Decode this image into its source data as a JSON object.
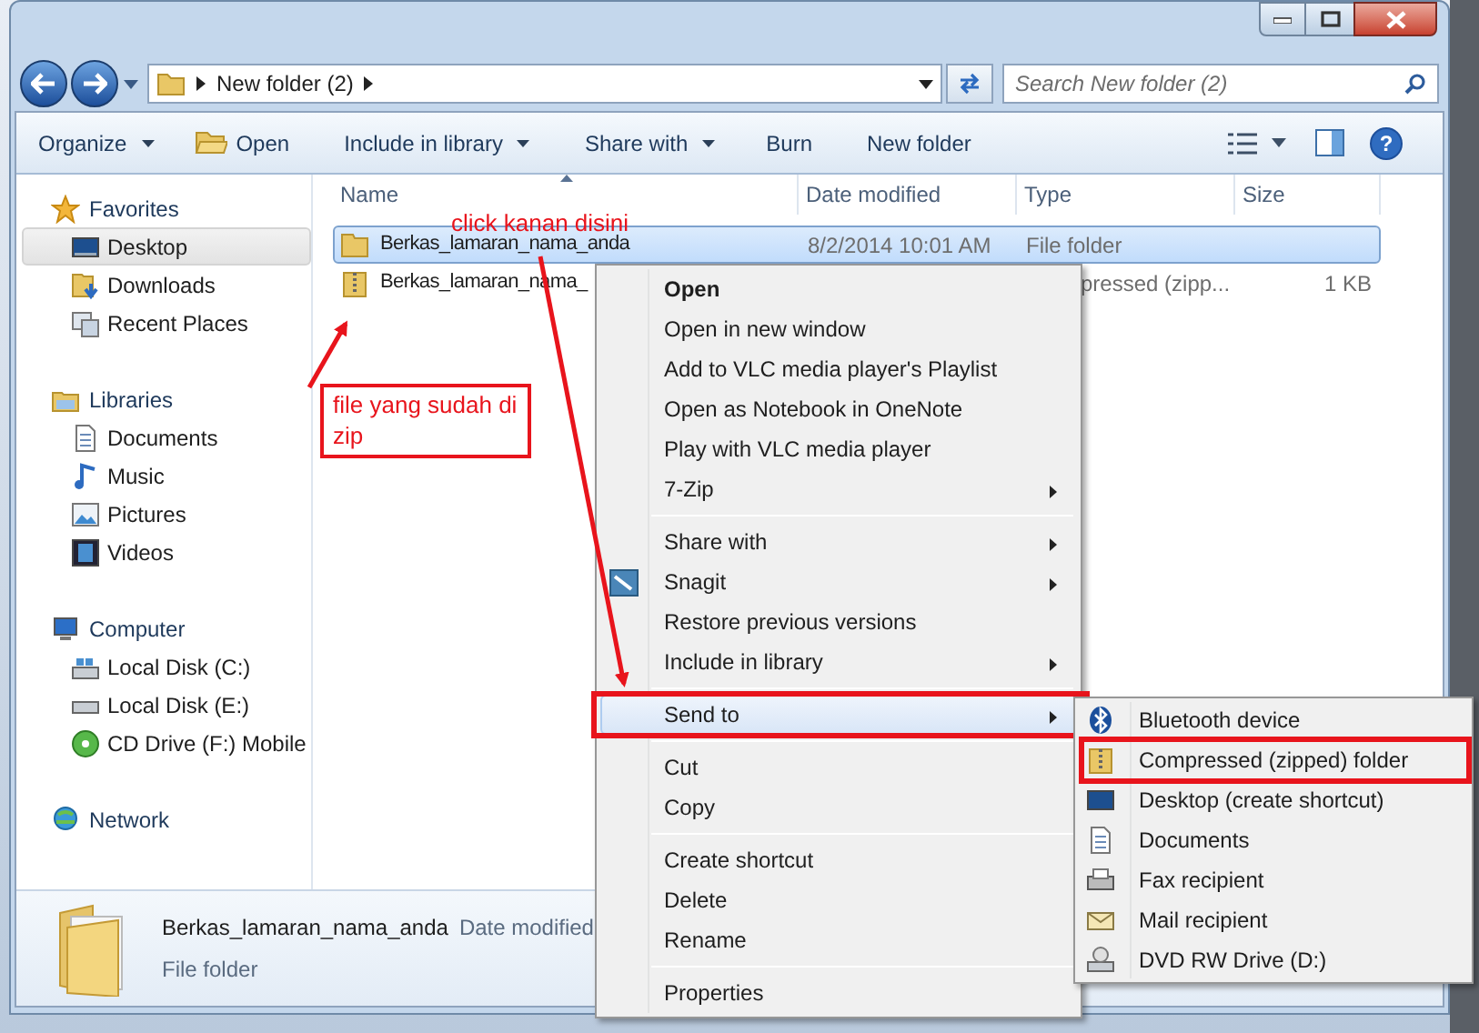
{
  "address_bar": {
    "breadcrumb": [
      "New folder (2)"
    ]
  },
  "search": {
    "placeholder": "Search New folder (2)"
  },
  "toolbar": [
    {
      "label": "Organize",
      "dropdown": true
    },
    {
      "label": "Open",
      "dropdown": false
    },
    {
      "label": "Include in library",
      "dropdown": true
    },
    {
      "label": "Share with",
      "dropdown": true
    },
    {
      "label": "Burn",
      "dropdown": false
    },
    {
      "label": "New folder",
      "dropdown": false
    }
  ],
  "sidebar": [
    {
      "label": "Favorites",
      "children": [
        {
          "label": "Desktop",
          "selected": true
        },
        {
          "label": "Downloads",
          "selected": false
        },
        {
          "label": "Recent Places",
          "selected": false
        }
      ]
    },
    {
      "label": "Libraries",
      "children": [
        {
          "label": "Documents",
          "selected": false
        },
        {
          "label": "Music",
          "selected": false
        },
        {
          "label": "Pictures",
          "selected": false
        },
        {
          "label": "Videos",
          "selected": false
        }
      ]
    },
    {
      "label": "Computer",
      "children": [
        {
          "label": "Local Disk (C:)",
          "selected": false
        },
        {
          "label": "Local Disk (E:)",
          "selected": false
        },
        {
          "label": "CD Drive (F:) Mobile",
          "selected": false
        }
      ]
    },
    {
      "label": "Network"
    }
  ],
  "help_button": "?",
  "table": {
    "columns": [
      "Name",
      "Date modified",
      "Type",
      "Size"
    ],
    "rows": [
      {
        "kind": "folder",
        "name": "Berkas_lamaran_nama_anda",
        "date": "8/2/2014 10:01 AM",
        "type": "File folder",
        "size": "",
        "selected": true
      },
      {
        "kind": "zip",
        "name": "Berkas_lamaran_nama_",
        "date": "",
        "type": "pressed (zipp...",
        "size": "1 KB",
        "selected": false
      }
    ]
  },
  "details": {
    "name": "Berkas_lamaran_nama_anda",
    "field": "Date modified",
    "type": "File folder"
  },
  "context_menu": [
    {
      "kind": "item",
      "label": "Open",
      "bold": true,
      "submenu": false,
      "selected": false,
      "marked": false
    },
    {
      "kind": "item",
      "label": "Open in new window",
      "bold": false,
      "submenu": false,
      "selected": false,
      "marked": false
    },
    {
      "kind": "item",
      "label": "Add to VLC media player's Playlist",
      "bold": false,
      "submenu": false,
      "selected": false,
      "marked": false
    },
    {
      "kind": "item",
      "label": "Open as Notebook in OneNote",
      "bold": false,
      "submenu": false,
      "selected": false,
      "marked": false
    },
    {
      "kind": "item",
      "label": "Play with VLC media player",
      "bold": false,
      "submenu": false,
      "selected": false,
      "marked": false
    },
    {
      "kind": "item",
      "label": "7-Zip",
      "bold": false,
      "submenu": true,
      "selected": false,
      "marked": false
    },
    {
      "kind": "separator"
    },
    {
      "kind": "item",
      "label": "Share with",
      "bold": false,
      "submenu": true,
      "selected": false,
      "marked": false
    },
    {
      "kind": "item",
      "label": "Snagit",
      "bold": false,
      "submenu": true,
      "selected": false,
      "marked": false
    },
    {
      "kind": "item",
      "label": "Restore previous versions",
      "bold": false,
      "submenu": false,
      "selected": false,
      "marked": false
    },
    {
      "kind": "item",
      "label": "Include in library",
      "bold": false,
      "submenu": true,
      "selected": false,
      "marked": false
    },
    {
      "kind": "separator"
    },
    {
      "kind": "item",
      "label": "Send to",
      "bold": false,
      "submenu": true,
      "selected": true,
      "marked": true
    },
    {
      "kind": "separator"
    },
    {
      "kind": "item",
      "label": "Cut",
      "bold": false,
      "submenu": false,
      "selected": false,
      "marked": false
    },
    {
      "kind": "item",
      "label": "Copy",
      "bold": false,
      "submenu": false,
      "selected": false,
      "marked": false
    },
    {
      "kind": "separator"
    },
    {
      "kind": "item",
      "label": "Create shortcut",
      "bold": false,
      "submenu": false,
      "selected": false,
      "marked": false
    },
    {
      "kind": "item",
      "label": "Delete",
      "bold": false,
      "submenu": false,
      "selected": false,
      "marked": false
    },
    {
      "kind": "item",
      "label": "Rename",
      "bold": false,
      "submenu": false,
      "selected": false,
      "marked": false
    },
    {
      "kind": "separator"
    },
    {
      "kind": "item",
      "label": "Properties",
      "bold": false,
      "submenu": false,
      "selected": false,
      "marked": false
    }
  ],
  "send_to_menu": [
    {
      "label": "Bluetooth device",
      "marked": false
    },
    {
      "label": "Compressed (zipped) folder",
      "marked": true
    },
    {
      "label": "Desktop (create shortcut)",
      "marked": false
    },
    {
      "label": "Documents",
      "marked": false
    },
    {
      "label": "Fax recipient",
      "marked": false
    },
    {
      "label": "Mail recipient",
      "marked": false
    },
    {
      "label": "DVD RW Drive (D:)",
      "marked": false
    }
  ],
  "annotations": {
    "label": "click kanan disini",
    "callout": "file yang sudah di zip"
  }
}
